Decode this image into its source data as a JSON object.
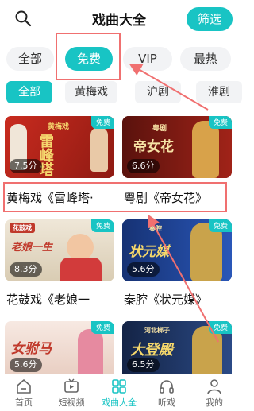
{
  "header": {
    "title": "戏曲大全",
    "filter_label": "筛选",
    "search_icon": "search-icon"
  },
  "tabs_primary": [
    {
      "label": "全部",
      "active": false
    },
    {
      "label": "免费",
      "active": true
    },
    {
      "label": "VIP",
      "active": false
    },
    {
      "label": "最热",
      "active": false
    }
  ],
  "tabs_secondary": [
    {
      "label": "全部",
      "active": true
    },
    {
      "label": "黄梅戏",
      "active": false
    },
    {
      "label": "沪剧",
      "active": false
    },
    {
      "label": "淮剧",
      "active": false
    }
  ],
  "cards": [
    {
      "badge": "免费",
      "score": "7.5分",
      "caption": "黄梅戏《雷峰塔·",
      "thumb_label": "黄梅戏",
      "thumb_title": "雷峰塔",
      "bg": "#b7261d"
    },
    {
      "badge": "免费",
      "score": "6.6分",
      "caption": "粤剧《帝女花》",
      "thumb_label": "粤剧",
      "thumb_title": "帝女花",
      "bg": "#7b1b14"
    },
    {
      "badge": "免费",
      "score": "8.3分",
      "caption": "花鼓戏《老娘一",
      "thumb_label": "花鼓戏",
      "thumb_title": "老娘一生",
      "bg": "#e9e0cf"
    },
    {
      "badge": "免费",
      "score": "5.6分",
      "caption": "秦腔《状元媒》",
      "thumb_label": "秦腔",
      "thumb_title": "状元媒",
      "bg": "#1c3f95"
    },
    {
      "badge": "免费",
      "score": "5.6分",
      "caption": "",
      "thumb_label": "",
      "thumb_title": "女驸马",
      "bg": "#f1dfd6"
    },
    {
      "badge": "免费",
      "score": "6.5分",
      "caption": "",
      "thumb_label": "河北梆子",
      "thumb_title": "大登殿",
      "bg": "#1d2f5c"
    }
  ],
  "bottom_nav": [
    {
      "label": "首页",
      "icon": "home-icon",
      "active": false
    },
    {
      "label": "短视频",
      "icon": "video-icon",
      "active": false
    },
    {
      "label": "戏曲大全",
      "icon": "grid-icon",
      "active": true
    },
    {
      "label": "听戏",
      "icon": "headphones-icon",
      "active": false
    },
    {
      "label": "我的",
      "icon": "user-icon",
      "active": false
    }
  ],
  "colors": {
    "accent": "#18c4c4",
    "annotation": "#f07070"
  }
}
